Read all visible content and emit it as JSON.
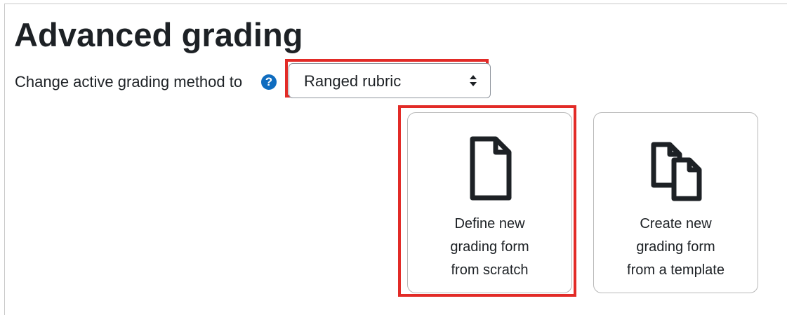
{
  "page": {
    "title": "Advanced grading"
  },
  "method": {
    "label": "Change active grading method to",
    "help_icon_glyph": "?",
    "selected_value": "Ranged rubric",
    "help_icon": "help-circle-icon",
    "select_icon": "sort-icon"
  },
  "cards": [
    {
      "icon": "document-icon",
      "lines": [
        "Define new",
        "grading form",
        "from scratch"
      ]
    },
    {
      "icon": "copy-documents-icon",
      "lines": [
        "Create new",
        "grading form",
        "from a template"
      ]
    }
  ],
  "colors": {
    "highlight": "#e22b27",
    "help_icon": "#0f6cbf",
    "text": "#1d2125",
    "card_border": "#b8b8b8"
  }
}
